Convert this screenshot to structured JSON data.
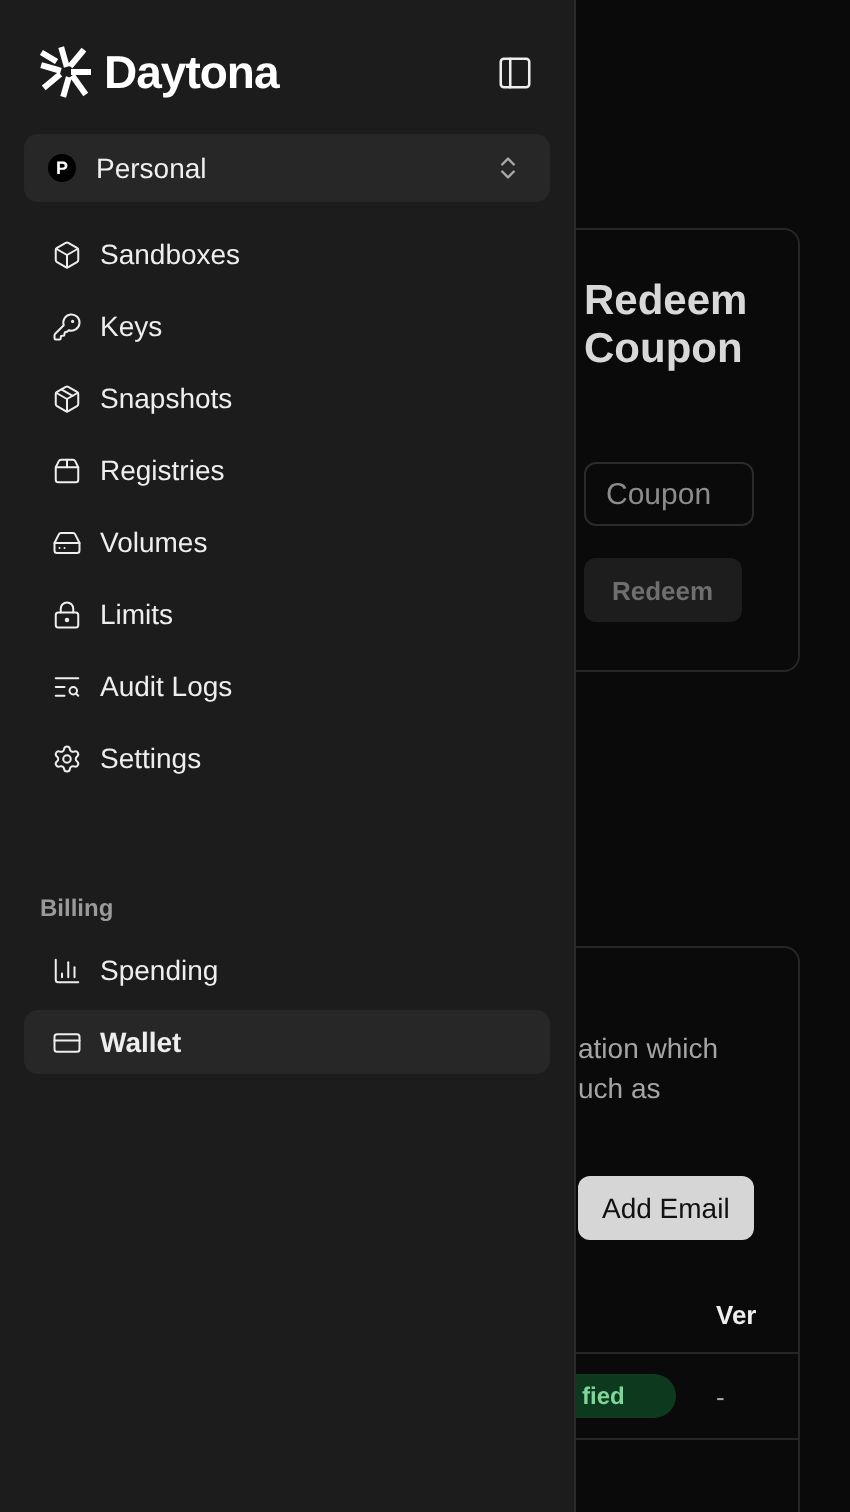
{
  "sidebar": {
    "brand": "Daytona",
    "workspace": {
      "initial": "P",
      "name": "Personal"
    },
    "items": [
      {
        "label": "Sandboxes",
        "selected": false
      },
      {
        "label": "Keys",
        "selected": false
      },
      {
        "label": "Snapshots",
        "selected": false
      },
      {
        "label": "Registries",
        "selected": false
      },
      {
        "label": "Volumes",
        "selected": false
      },
      {
        "label": "Limits",
        "selected": false
      },
      {
        "label": "Audit Logs",
        "selected": false
      },
      {
        "label": "Settings",
        "selected": false
      }
    ],
    "billing": {
      "title": "Billing",
      "items": [
        {
          "label": "Spending",
          "selected": false
        },
        {
          "label": "Wallet",
          "selected": true
        }
      ]
    }
  },
  "coupon_card": {
    "title": "Redeem Coupon",
    "field": {
      "placeholder": "Coupon"
    },
    "button": {
      "label": "Redeem",
      "disabled": true
    }
  },
  "email_card": {
    "description_lines": [
      "ation which",
      "uch as"
    ],
    "button": {
      "label": "Add Email"
    },
    "table": {
      "columns": [
        "Ver"
      ],
      "rows": [
        {
          "status": "fied",
          "column_2": "-"
        }
      ]
    }
  }
}
